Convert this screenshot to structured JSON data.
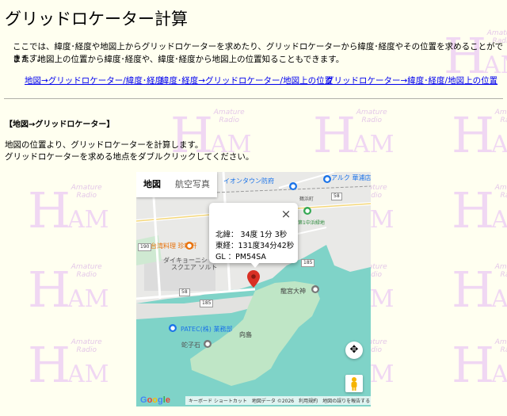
{
  "page": {
    "title": "グリッドロケーター計算",
    "intro_line1": "ここでは、緯度･経度や地図上からグリッドロケーターを求めたり、グリッドロケーターから緯度･経度やその位置を求めることができます。",
    "intro_line2": "また、地図上の位置から緯度･経度や、緯度･経度から地図上の位置知ることもできます。",
    "nav_links": [
      "地図→グリッドロケーター/緯度･経度",
      "緯度･経度→グリッドロケーター/地図上の位置",
      "グリッドロケーター→緯度･経度/地図上の位置"
    ],
    "section_title": "【地図→グリッドロケーター】",
    "desc_line1": "地図の位置より、グリッドロケーターを計算します。",
    "desc_line2": "グリッドロケーターを求める地点をダブルクリックしてください。"
  },
  "watermark": {
    "letters_big": "H",
    "letters_small": "AM",
    "tagline": "Amature Radio"
  },
  "map": {
    "tabs": {
      "map": "地図",
      "satellite": "航空写真"
    },
    "labels": {
      "aeon": "イオンタウン防府",
      "arc": "アルク 華浦店",
      "taiwan": "台湾料理 珍味軒",
      "daikin": "ダイキョーニシ",
      "square": "スクエア ソルト",
      "ryugu": "龍宮大神",
      "patec": "PATEC(株) 業務部",
      "mukoshima": "向島",
      "hebiko": "蛇子石",
      "park": "第1中浜緑地",
      "tsuru": "鶴浜町"
    },
    "road_numbers": [
      "58",
      "190",
      "58",
      "185",
      "185"
    ],
    "info_window": {
      "lat": "北緯：  34度  1分  3秒",
      "lon": "東経：131度34分42秒",
      "gl": "GL   ：PM54SA",
      "close": "×"
    },
    "attribution": [
      "キーボード ショートカット",
      "地図データ ©2026",
      "利用規約",
      "地図の誤りを報告する"
    ],
    "logo": "Google",
    "colors": {
      "water": "#7fd3c8",
      "land": "#e8e8e8",
      "green": "#bfe6c6",
      "marker": "#d93025"
    }
  }
}
